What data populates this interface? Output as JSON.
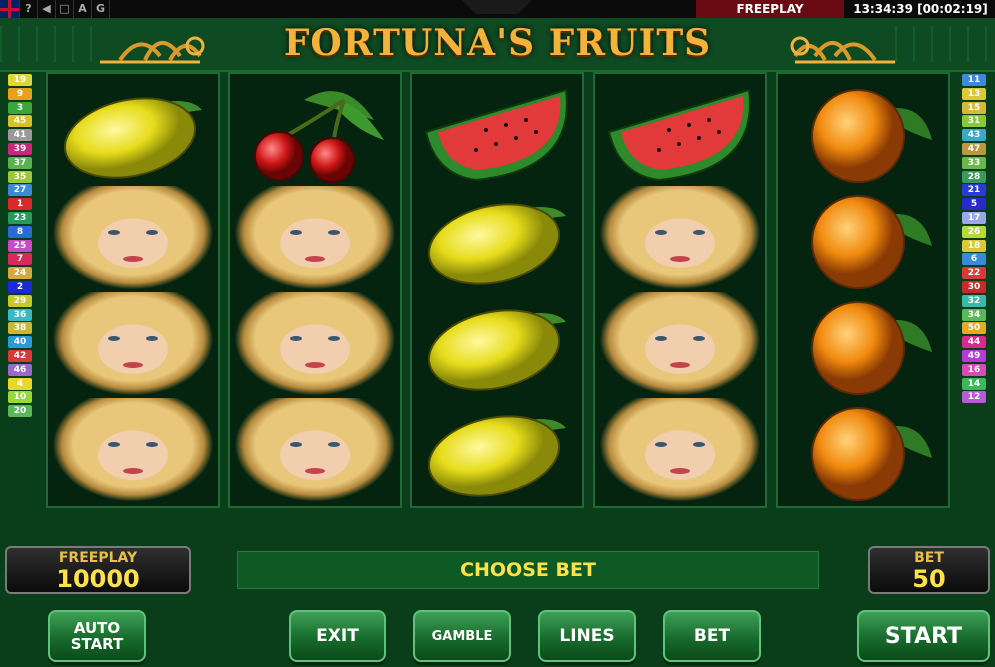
{
  "topbar": {
    "icons": [
      "uk-flag-icon",
      "help-icon",
      "sound-icon",
      "fullscreen-icon"
    ],
    "help": "?",
    "a_label": "A",
    "g_label": "G",
    "mode": "FREEPLAY",
    "clock": "13:34:39 [00:02:19]"
  },
  "title": "FORTUNA'S FRUITS",
  "left_lines": [
    {
      "n": "19",
      "c": "#e0d63a"
    },
    {
      "n": "9",
      "c": "#e8a21a"
    },
    {
      "n": "3",
      "c": "#3aa63a"
    },
    {
      "n": "45",
      "c": "#d8c028"
    },
    {
      "n": "41",
      "c": "#9a9a9a"
    },
    {
      "n": "39",
      "c": "#c8287a"
    },
    {
      "n": "37",
      "c": "#5ab04a"
    },
    {
      "n": "35",
      "c": "#9ac83a"
    },
    {
      "n": "27",
      "c": "#3a8ad8"
    },
    {
      "n": "1",
      "c": "#d82a2a"
    },
    {
      "n": "23",
      "c": "#2a9a5a"
    },
    {
      "n": "8",
      "c": "#2a6ad8"
    },
    {
      "n": "25",
      "c": "#c84ac8"
    },
    {
      "n": "7",
      "c": "#d82a5a"
    },
    {
      "n": "24",
      "c": "#d8a83a"
    },
    {
      "n": "2",
      "c": "#1a2ad8"
    },
    {
      "n": "29",
      "c": "#c8c82a"
    },
    {
      "n": "36",
      "c": "#3ab8c8"
    },
    {
      "n": "38",
      "c": "#c8b83a"
    },
    {
      "n": "40",
      "c": "#2a9ad8"
    },
    {
      "n": "42",
      "c": "#d83a3a"
    },
    {
      "n": "46",
      "c": "#9a6ac8"
    },
    {
      "n": "4",
      "c": "#e8d82a"
    },
    {
      "n": "10",
      "c": "#9ad83a"
    },
    {
      "n": "20",
      "c": "#5ab85a"
    }
  ],
  "right_lines": [
    {
      "n": "11",
      "c": "#3a8ad8"
    },
    {
      "n": "13",
      "c": "#d8c83a"
    },
    {
      "n": "15",
      "c": "#d8b83a"
    },
    {
      "n": "31",
      "c": "#8ac83a"
    },
    {
      "n": "43",
      "c": "#3aa8c8"
    },
    {
      "n": "47",
      "c": "#b89a3a"
    },
    {
      "n": "33",
      "c": "#6ab84a"
    },
    {
      "n": "28",
      "c": "#3a9a5a"
    },
    {
      "n": "21",
      "c": "#2a3ad8"
    },
    {
      "n": "5",
      "c": "#2a2ac8"
    },
    {
      "n": "17",
      "c": "#9aa8e8"
    },
    {
      "n": "26",
      "c": "#b8d83a"
    },
    {
      "n": "18",
      "c": "#d8c83a"
    },
    {
      "n": "6",
      "c": "#3a8ad8"
    },
    {
      "n": "22",
      "c": "#d83a3a"
    },
    {
      "n": "30",
      "c": "#c82a2a"
    },
    {
      "n": "32",
      "c": "#3ab8a8"
    },
    {
      "n": "34",
      "c": "#5ab85a"
    },
    {
      "n": "50",
      "c": "#e8a82a"
    },
    {
      "n": "44",
      "c": "#d82a8a"
    },
    {
      "n": "49",
      "c": "#b83ad8"
    },
    {
      "n": "16",
      "c": "#d84ab8"
    },
    {
      "n": "14",
      "c": "#3ab85a"
    },
    {
      "n": "12",
      "c": "#b85ad8"
    }
  ],
  "reels": [
    [
      "lemon",
      "lady",
      "lady",
      "lady"
    ],
    [
      "cherries",
      "lady",
      "lady",
      "lady"
    ],
    [
      "watermelon",
      "lemon",
      "lemon",
      "lemon"
    ],
    [
      "watermelon",
      "lady",
      "lady",
      "lady"
    ],
    [
      "orange",
      "orange",
      "orange",
      "orange"
    ]
  ],
  "credit": {
    "label": "FREEPLAY",
    "value": "10000"
  },
  "message": "CHOOSE BET",
  "bet": {
    "label": "BET",
    "value": "50"
  },
  "buttons": {
    "auto_start_1": "AUTO",
    "auto_start_2": "START",
    "exit": "EXIT",
    "gamble": "GAMBLE",
    "lines": "LINES",
    "bet": "BET",
    "start": "START"
  },
  "colors": {
    "felt": "#0a3d1a",
    "gold": "#f3b33b",
    "digits": "#ffe14a"
  }
}
